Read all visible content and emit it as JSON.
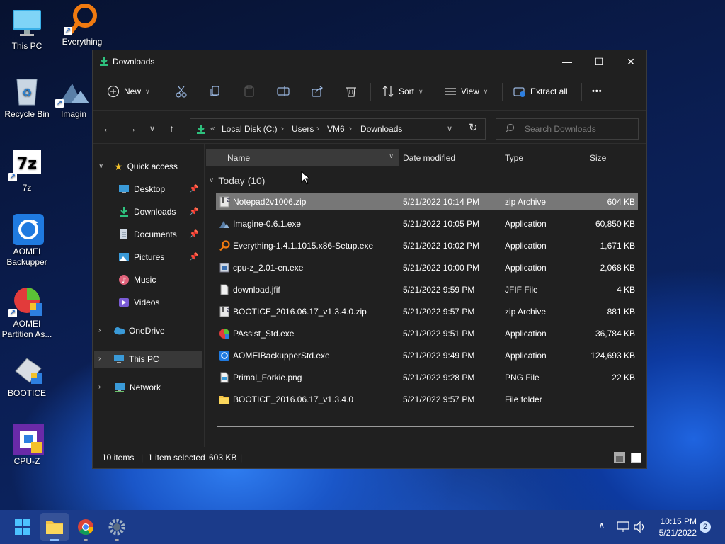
{
  "desktop": {
    "icons": [
      {
        "label": "This PC"
      },
      {
        "label": "Everything"
      },
      {
        "label": "Recycle Bin"
      },
      {
        "label": "Imagin"
      },
      {
        "label": "7z"
      },
      {
        "label": "AOMEI Backupper"
      },
      {
        "label": "AOMEI Partition As..."
      },
      {
        "label": "BOOTICE"
      },
      {
        "label": "CPU-Z"
      }
    ],
    "seven_z_glyph": "7z"
  },
  "window": {
    "title": "Downloads",
    "controls": {
      "minimize": "—",
      "maximize": "☐",
      "close": "✕"
    }
  },
  "toolbar": {
    "new_label": "New",
    "sort_label": "Sort",
    "view_label": "View",
    "extract_label": "Extract all",
    "more_label": "•••"
  },
  "address": {
    "overflow": "«",
    "crumbs": [
      "Local Disk (C:)",
      "Users",
      "VM6",
      "Downloads"
    ],
    "separator": "›",
    "search_placeholder": "Search Downloads"
  },
  "sidebar": {
    "quick_access": "Quick access",
    "items": [
      {
        "label": "Desktop",
        "pinned": true
      },
      {
        "label": "Downloads",
        "pinned": true
      },
      {
        "label": "Documents",
        "pinned": true
      },
      {
        "label": "Pictures",
        "pinned": true
      },
      {
        "label": "Music",
        "pinned": false
      },
      {
        "label": "Videos",
        "pinned": false
      }
    ],
    "onedrive": "OneDrive",
    "this_pc": "This PC",
    "network": "Network"
  },
  "columns": {
    "name": "Name",
    "date": "Date modified",
    "type": "Type",
    "size": "Size"
  },
  "group": {
    "label": "Today (10)"
  },
  "files": [
    {
      "name": "Notepad2v1006.zip",
      "date": "5/21/2022 10:14 PM",
      "type": "zip Archive",
      "size": "604 KB",
      "icon": "zip-icon",
      "selected": true
    },
    {
      "name": "Imagine-0.6.1.exe",
      "date": "5/21/2022 10:05 PM",
      "type": "Application",
      "size": "60,850 KB",
      "icon": "imagine-icon"
    },
    {
      "name": "Everything-1.4.1.1015.x86-Setup.exe",
      "date": "5/21/2022 10:02 PM",
      "type": "Application",
      "size": "1,671 KB",
      "icon": "everything-icon"
    },
    {
      "name": "cpu-z_2.01-en.exe",
      "date": "5/21/2022 10:00 PM",
      "type": "Application",
      "size": "2,068 KB",
      "icon": "setup-icon"
    },
    {
      "name": "download.jfif",
      "date": "5/21/2022 9:59 PM",
      "type": "JFIF File",
      "size": "4 KB",
      "icon": "file-icon"
    },
    {
      "name": "BOOTICE_2016.06.17_v1.3.4.0.zip",
      "date": "5/21/2022 9:57 PM",
      "type": "zip Archive",
      "size": "881 KB",
      "icon": "zip-icon"
    },
    {
      "name": "PAssist_Std.exe",
      "date": "5/21/2022 9:51 PM",
      "type": "Application",
      "size": "36,784 KB",
      "icon": "passist-icon"
    },
    {
      "name": "AOMEIBackupperStd.exe",
      "date": "5/21/2022 9:49 PM",
      "type": "Application",
      "size": "124,693 KB",
      "icon": "aomei-icon"
    },
    {
      "name": "Primal_Forkie.png",
      "date": "5/21/2022 9:28 PM",
      "type": "PNG File",
      "size": "22 KB",
      "icon": "image-icon"
    },
    {
      "name": "BOOTICE_2016.06.17_v1.3.4.0",
      "date": "5/21/2022 9:57 PM",
      "type": "File folder",
      "size": "",
      "icon": "folder-icon"
    }
  ],
  "status": {
    "items": "10 items",
    "selected": "1 item selected",
    "size": "603 KB",
    "sep": "|"
  },
  "taskbar": {
    "time": "10:15 PM",
    "date": "5/21/2022",
    "notifications": "2",
    "chevron": "∧"
  },
  "colors": {
    "accent": "#0078d4",
    "folder": "#f6c445",
    "selected_row": "#777777"
  }
}
